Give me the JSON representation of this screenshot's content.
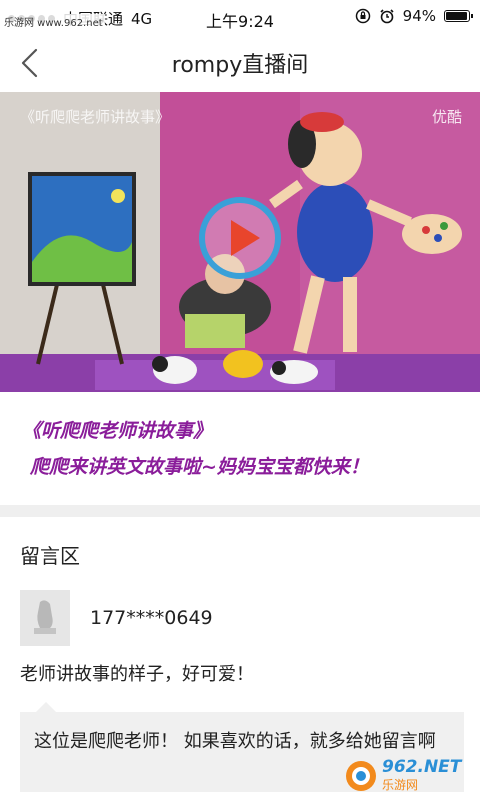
{
  "status_bar": {
    "carrier": "中国联通",
    "network": "4G",
    "time": "上午9:24",
    "battery": "94%",
    "battery_level": 0.94,
    "watermark": "乐游网 www.962.net"
  },
  "nav": {
    "title": "rompy直播间"
  },
  "video": {
    "overlay_title": "听爬爬老师讲故事",
    "source_logo": "优酷"
  },
  "captions": {
    "line1": "《听爬爬老师讲故事》",
    "line2": "爬爬来讲英文故事啦~妈妈宝宝都快来！"
  },
  "comments": {
    "section_title": "留言区",
    "items": [
      {
        "user": "177****0649",
        "text": "老师讲故事的样子，好可爱！",
        "reply": "这位是爬爬老师！ 如果喜欢的话，就多给她留言啊"
      }
    ]
  },
  "badge": {
    "text": "962.NET",
    "sub": "乐游网"
  },
  "colors": {
    "caption": "#8a1d9a",
    "play_ring": "#3aa0d8",
    "play_triangle": "#e8452c"
  }
}
